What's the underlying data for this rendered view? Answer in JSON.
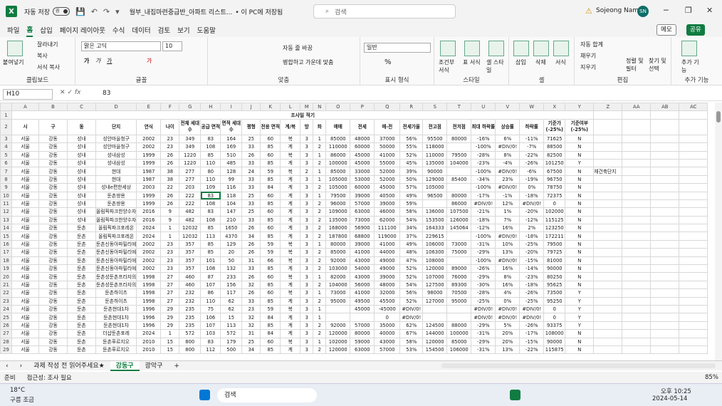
{
  "title_bar": {
    "autosave_label": "자동 저장",
    "autosave_state": "끔",
    "filename": "월부_내집마련중급반_아파트 리스트...",
    "saved_status": "• 이 PC에 저장됨",
    "search_placeholder": "검색",
    "user_name": "Sojeong Nam",
    "user_initials": "SN"
  },
  "menu": {
    "tabs": [
      "파일",
      "홈",
      "삽입",
      "페이지 레이아웃",
      "수식",
      "데이터",
      "검토",
      "보기",
      "도움말"
    ],
    "active": "홈",
    "memo": "메모",
    "share": "공유"
  },
  "ribbon": {
    "clipboard": {
      "label": "클립보드",
      "paste": "붙여넣기",
      "cut": "잘라내기",
      "copy": "복사",
      "format_painter": "서식 복사"
    },
    "font": {
      "label": "글꼴",
      "font_name": "맑은 고딕",
      "font_size": "10"
    },
    "align": {
      "label": "맞춤",
      "wrap": "자동 줄 바꿈",
      "merge": "병합하고 가운데 맞춤"
    },
    "number": {
      "label": "표시 형식",
      "format": "일반"
    },
    "styles": {
      "label": "스타일",
      "conditional": "조건부 서식",
      "table": "표 서식",
      "cell_style": "셀 스타일"
    },
    "cells": {
      "label": "셀",
      "insert": "삽입",
      "delete": "삭제",
      "format": "서식"
    },
    "editing": {
      "label": "편집",
      "autosum": "자동 합계",
      "fill": "채우기",
      "clear": "지우기",
      "sort": "정렬 및 필터",
      "find": "찾기 및 선택"
    },
    "addins": {
      "label": "추가 기능",
      "addins": "추가 기능"
    }
  },
  "formula_bar": {
    "name_box": "H10",
    "value": "83"
  },
  "columns": [
    "A",
    "B",
    "C",
    "D",
    "E",
    "F",
    "G",
    "H",
    "I",
    "J",
    "K",
    "L",
    "M",
    "N",
    "O",
    "P",
    "Q",
    "R",
    "S",
    "T",
    "U",
    "V",
    "W",
    "X",
    "Y",
    "Z",
    "AA",
    "AB",
    "AC"
  ],
  "sheet_title": "조사일 적기",
  "headers": [
    "시",
    "구",
    "동",
    "단지",
    "연식",
    "나이",
    "전체 세대수",
    "공급 면적",
    "면적 세대수",
    "평형",
    "전용 면적",
    "계/복",
    "방",
    "화",
    "매매",
    "전세",
    "매-전",
    "전세가율",
    "전고점",
    "전저점",
    "최대 하락률",
    "상승률",
    "하락률",
    "기준가 (-25%)",
    "기준여부 (-25%)"
  ],
  "rows": [
    [
      "서울",
      "강동",
      "성내",
      "성안마을청구",
      "2002",
      "23",
      "349",
      "83",
      "164",
      "25",
      "60",
      "복",
      "3",
      "1",
      "85000",
      "48000",
      "37000",
      "56%",
      "95500",
      "80000",
      "-16%",
      "6%",
      "-11%",
      "71625",
      "N",
      ""
    ],
    [
      "서울",
      "강동",
      "성내",
      "성안마을청구",
      "2002",
      "23",
      "349",
      "108",
      "169",
      "33",
      "85",
      "계",
      "3",
      "2",
      "110000",
      "60000",
      "50000",
      "55%",
      "118000",
      "",
      "-100%",
      "#DIV/0!",
      "-7%",
      "88500",
      "N",
      ""
    ],
    [
      "서울",
      "강동",
      "성내",
      "성내삼성",
      "1999",
      "26",
      "1220",
      "85",
      "510",
      "26",
      "60",
      "복",
      "3",
      "1",
      "86000",
      "45000",
      "41000",
      "52%",
      "110000",
      "79500",
      "-28%",
      "8%",
      "-22%",
      "82500",
      "N",
      ""
    ],
    [
      "서울",
      "강동",
      "성내",
      "성내삼성",
      "1999",
      "26",
      "1220",
      "110",
      "485",
      "33",
      "85",
      "계",
      "3",
      "2",
      "100000",
      "45000",
      "55000",
      "45%",
      "135000",
      "104000",
      "-23%",
      "-4%",
      "-26%",
      "101250",
      "Y",
      ""
    ],
    [
      "서울",
      "강동",
      "성내",
      "현대",
      "1987",
      "38",
      "277",
      "80",
      "128",
      "24",
      "59",
      "복",
      "2",
      "1",
      "85000",
      "33000",
      "52000",
      "39%",
      "90000",
      "",
      "-100%",
      "#DIV/0!",
      "-6%",
      "67500",
      "N",
      "재건축단지"
    ],
    [
      "서울",
      "강동",
      "성내",
      "현대",
      "1987",
      "38",
      "277",
      "110",
      "99",
      "33",
      "85",
      "계",
      "3",
      "1",
      "105000",
      "53000",
      "52000",
      "50%",
      "129000",
      "85400",
      "-34%",
      "23%",
      "-19%",
      "96750",
      "N",
      ""
    ],
    [
      "서울",
      "강동",
      "성내",
      "성내e편한세상",
      "2003",
      "22",
      "203",
      "109",
      "116",
      "33",
      "84",
      "계",
      "3",
      "2",
      "105000",
      "60000",
      "45000",
      "57%",
      "105000",
      "",
      "-100%",
      "#DIV/0!",
      "0%",
      "78750",
      "N",
      ""
    ],
    [
      "서울",
      "강동",
      "성내",
      "둔촌쌍용",
      "1999",
      "26",
      "222",
      "83",
      "118",
      "25",
      "60",
      "계",
      "3",
      "1",
      "79500",
      "39000",
      "40500",
      "49%",
      "96500",
      "80000",
      "-17%",
      "-1%",
      "-18%",
      "72375",
      "N",
      ""
    ],
    [
      "서울",
      "강동",
      "성내",
      "둔촌쌍용",
      "1999",
      "26",
      "222",
      "108",
      "104",
      "33",
      "85",
      "계",
      "3",
      "2",
      "96000",
      "57000",
      "39000",
      "59%",
      "",
      "86000",
      "#DIV/0!",
      "12%",
      "#DIV/0!",
      "0",
      "N",
      ""
    ],
    [
      "서울",
      "강동",
      "성내",
      "올림픽파크한양수자",
      "2016",
      "9",
      "482",
      "83",
      "147",
      "25",
      "60",
      "계",
      "3",
      "2",
      "109000",
      "63000",
      "46000",
      "58%",
      "136000",
      "107500",
      "-21%",
      "1%",
      "-20%",
      "102000",
      "N",
      ""
    ],
    [
      "서울",
      "강동",
      "성내",
      "올림픽파크한양수자",
      "2016",
      "9",
      "482",
      "108",
      "210",
      "33",
      "85",
      "계",
      "3",
      "2",
      "135000",
      "73000",
      "62000",
      "54%",
      "153500",
      "126000",
      "-18%",
      "7%",
      "-12%",
      "115125",
      "N",
      ""
    ],
    [
      "서울",
      "강동",
      "둔촌",
      "올림픽파크포레온",
      "2024",
      "1",
      "12032",
      "85",
      "1650",
      "26",
      "60",
      "계",
      "3",
      "2",
      "168000",
      "56900",
      "111100",
      "34%",
      "164333",
      "145064",
      "-12%",
      "16%",
      "2%",
      "123250",
      "N",
      ""
    ],
    [
      "서울",
      "강동",
      "둔촌",
      "올림픽파크포레온",
      "2024",
      "1",
      "12032",
      "113",
      "4370",
      "34",
      "85",
      "계",
      "3",
      "2",
      "187800",
      "68800",
      "119000",
      "37%",
      "229615",
      "",
      "-100%",
      "#DIV/0!",
      "-18%",
      "172211",
      "N",
      ""
    ],
    [
      "서울",
      "강동",
      "둔촌",
      "둔촌신동아파밀리에",
      "2002",
      "23",
      "357",
      "85",
      "129",
      "26",
      "59",
      "복",
      "3",
      "1",
      "80000",
      "39000",
      "41000",
      "49%",
      "106000",
      "73000",
      "-31%",
      "10%",
      "-25%",
      "79500",
      "N",
      ""
    ],
    [
      "서울",
      "강동",
      "둔촌",
      "둔촌신동아파밀리에",
      "2002",
      "23",
      "357",
      "85",
      "20",
      "26",
      "59",
      "복",
      "3",
      "2",
      "85000",
      "41000",
      "44000",
      "48%",
      "106300",
      "75000",
      "-29%",
      "13%",
      "-20%",
      "79725",
      "N",
      ""
    ],
    [
      "서울",
      "강동",
      "둔촌",
      "둔촌신동아파밀리에",
      "2002",
      "23",
      "357",
      "101",
      "50",
      "31",
      "66",
      "복",
      "3",
      "2",
      "92000",
      "43000",
      "49000",
      "47%",
      "108000",
      "",
      "-100%",
      "#DIV/0!",
      "-15%",
      "81000",
      "N",
      ""
    ],
    [
      "서울",
      "강동",
      "둔촌",
      "둔촌신동아파밀리에",
      "2002",
      "23",
      "357",
      "108",
      "132",
      "33",
      "85",
      "계",
      "3",
      "2",
      "103000",
      "54000",
      "49000",
      "52%",
      "120000",
      "89000",
      "-26%",
      "16%",
      "-14%",
      "90000",
      "N",
      ""
    ],
    [
      "서울",
      "강동",
      "둔촌",
      "둔촌성둔촌프라자의",
      "1998",
      "27",
      "460",
      "87",
      "233",
      "26",
      "60",
      "복",
      "3",
      "1",
      "82000",
      "43000",
      "39000",
      "52%",
      "107000",
      "76000",
      "-29%",
      "8%",
      "-23%",
      "80250",
      "N",
      ""
    ],
    [
      "서울",
      "강동",
      "둔촌",
      "둔촌성둔촌프라자의",
      "1998",
      "27",
      "460",
      "107",
      "156",
      "32",
      "85",
      "계",
      "3",
      "2",
      "104000",
      "56000",
      "48000",
      "54%",
      "127500",
      "89300",
      "-30%",
      "16%",
      "-18%",
      "95625",
      "N",
      ""
    ],
    [
      "서울",
      "강동",
      "둔촌",
      "둔촌하이츠",
      "1998",
      "27",
      "232",
      "86",
      "117",
      "26",
      "60",
      "복",
      "3",
      "1",
      "73000",
      "41000",
      "32000",
      "56%",
      "98000",
      "70500",
      "-28%",
      "4%",
      "-26%",
      "73500",
      "Y",
      ""
    ],
    [
      "서울",
      "강동",
      "둔촌",
      "둔촌하이츠",
      "1998",
      "27",
      "232",
      "110",
      "62",
      "33",
      "85",
      "계",
      "3",
      "2",
      "95000",
      "49500",
      "45500",
      "52%",
      "127000",
      "95000",
      "-25%",
      "0%",
      "-25%",
      "95250",
      "Y",
      ""
    ],
    [
      "서울",
      "강동",
      "둔촌",
      "둔촌현대1차",
      "1996",
      "29",
      "235",
      "75",
      "62",
      "23",
      "59",
      "복",
      "3",
      "1",
      "",
      "45000",
      "-45000",
      "#DIV/0!",
      "",
      "",
      "#DIV/0!",
      "#DIV/0!",
      "#DIV/0!",
      "0",
      "Y",
      ""
    ],
    [
      "서울",
      "강동",
      "둔촌",
      "둔촌현대1차",
      "1996",
      "29",
      "235",
      "106",
      "15",
      "32",
      "84",
      "계",
      "3",
      "1",
      "",
      "",
      "0",
      "#DIV/0!",
      "",
      "",
      "#DIV/0!",
      "#DIV/0!",
      "#DIV/0!",
      "0",
      "Y",
      ""
    ],
    [
      "서울",
      "강동",
      "둔촌",
      "둔촌현대1차",
      "1996",
      "29",
      "235",
      "107",
      "113",
      "32",
      "85",
      "계",
      "3",
      "2",
      "92000",
      "57000",
      "35000",
      "62%",
      "124500",
      "88000",
      "-29%",
      "5%",
      "-26%",
      "93375",
      "Y",
      ""
    ],
    [
      "서울",
      "강동",
      "둔촌",
      "더샵둔촌포레",
      "2024",
      "1",
      "572",
      "103",
      "572",
      "31",
      "84",
      "계",
      "3",
      "2",
      "120000",
      "80000",
      "40000",
      "67%",
      "144000",
      "100000",
      "-31%",
      "20%",
      "-17%",
      "108000",
      "N",
      ""
    ],
    [
      "서울",
      "강동",
      "둔촌",
      "둔촌푸르지오",
      "2010",
      "15",
      "800",
      "83",
      "179",
      "25",
      "60",
      "복",
      "3",
      "1",
      "102000",
      "59000",
      "43000",
      "58%",
      "120000",
      "85000",
      "-29%",
      "20%",
      "-15%",
      "90000",
      "N",
      ""
    ],
    [
      "서울",
      "강동",
      "둔촌",
      "둔촌푸르지오",
      "2010",
      "15",
      "800",
      "112",
      "500",
      "34",
      "85",
      "계",
      "3",
      "2",
      "120000",
      "63000",
      "57000",
      "53%",
      "154500",
      "106000",
      "-31%",
      "13%",
      "-22%",
      "115875",
      "N",
      ""
    ]
  ],
  "row_numbers": [
    "1",
    "2",
    "3",
    "4",
    "5",
    "6",
    "7",
    "8",
    "9",
    "10",
    "11",
    "12",
    "13",
    "14",
    "15",
    "16",
    "17",
    "18",
    "19",
    "20",
    "21",
    "22",
    "23",
    "24",
    "25",
    "26",
    "27",
    "28",
    "29"
  ],
  "sheet_tabs": {
    "tabs": [
      "과제 작성 전 읽어주세요★",
      "강동구",
      "광악구"
    ],
    "active": "강동구"
  },
  "status": {
    "ready": "준비",
    "accessibility": "접근성: 조사 필요",
    "zoom": "85%"
  },
  "taskbar": {
    "weather_temp": "18°C",
    "weather_desc": "구름 조금",
    "search": "검색",
    "time": "오후 10:25",
    "date": "2024-05-14"
  }
}
